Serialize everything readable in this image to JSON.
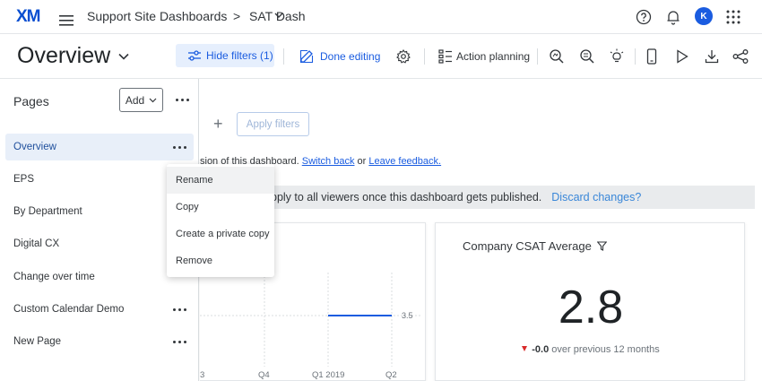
{
  "topnav": {
    "logo": "XM",
    "breadcrumb_parent": "Support Site Dashboards",
    "breadcrumb_sep": ">",
    "breadcrumb_current": "SAT Dash",
    "avatar_initial": "K"
  },
  "header": {
    "title": "Overview",
    "hide_filters_label": "Hide filters (1)",
    "done_editing_label": "Done editing",
    "action_planning_label": "Action planning"
  },
  "sidebar": {
    "title": "Pages",
    "add_label": "Add",
    "items": [
      {
        "label": "Overview"
      },
      {
        "label": "EPS"
      },
      {
        "label": "By Department"
      },
      {
        "label": "Digital CX"
      },
      {
        "label": "Change over time"
      },
      {
        "label": "Custom Calendar Demo"
      },
      {
        "label": "New Page"
      }
    ]
  },
  "filters": {
    "add_symbol": "+",
    "apply_label": "Apply filters"
  },
  "notice": {
    "prefix": "sion of this dashboard.",
    "switch_back": "Switch back",
    "middle": "or",
    "leave_feedback": "Leave feedback."
  },
  "banner": {
    "text": "pply to all viewers once this dashboard gets published.",
    "discard_link": "Discard changes?"
  },
  "line_chart": {
    "x_labels": [
      "3",
      "Q4",
      "Q1 2019",
      "Q2"
    ],
    "value_label": "3.5",
    "series_color": "#1a5ce0"
  },
  "kpi": {
    "title": "Company CSAT Average",
    "value": "2.8",
    "delta_value": "-0.0",
    "delta_text": "over previous 12 months",
    "delta_color": "#d92b2b"
  },
  "context_menu": {
    "items": [
      {
        "label": "Rename"
      },
      {
        "label": "Copy"
      },
      {
        "label": "Create a private copy"
      },
      {
        "label": "Remove"
      }
    ]
  },
  "colors": {
    "accent": "#1a5ce0",
    "active_bg": "#e8eff9"
  }
}
